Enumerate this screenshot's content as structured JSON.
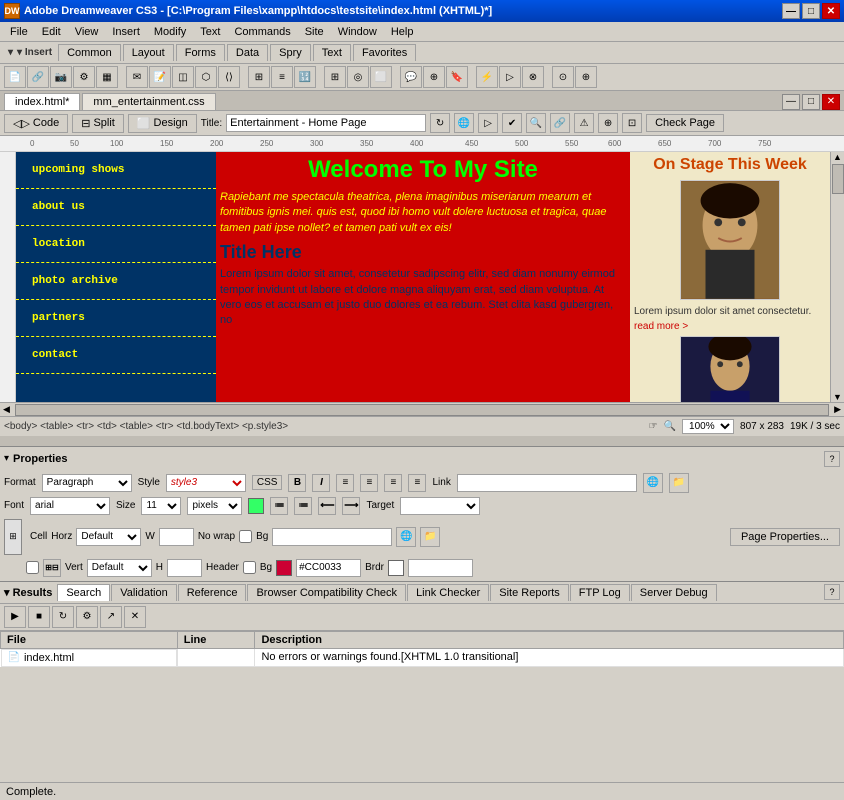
{
  "titlebar": {
    "title": "Adobe Dreamweaver CS3 - [C:\\Program Files\\xampp\\htdocs\\testsite\\index.html (XHTML)*]",
    "icon_label": "DW",
    "min_label": "—",
    "max_label": "□",
    "close_label": "✕"
  },
  "menubar": {
    "items": [
      "File",
      "Edit",
      "View",
      "Insert",
      "Modify",
      "Text",
      "Commands",
      "Site",
      "Window",
      "Help"
    ]
  },
  "insert_toolbar": {
    "label": "▾ Insert",
    "tabs": [
      "Common",
      "Layout",
      "Forms",
      "Data",
      "Spry",
      "Text",
      "Favorites"
    ]
  },
  "doc_tabs": {
    "tabs": [
      "index.html*",
      "mm_entertainment.css"
    ]
  },
  "doc_toolbar": {
    "code_btn": "Code",
    "split_btn": "Split",
    "design_btn": "Design",
    "title_label": "Title:",
    "title_value": "Entertainment - Home Page",
    "check_page_btn": "Check Page"
  },
  "nav_items": [
    "upcoming shows",
    "about us",
    "location",
    "photo archive",
    "partners",
    "contact"
  ],
  "site_title": "Welcome To My Site",
  "body_text": "Rapiebant me spectacula theatrica, plena imaginibus miseriarum mearum et fomitibus ignis mei. quis est, quod ibi homo vult dolere luctuosa et tragica, quae tamen pati ipse nollet? et tamen pati vult ex eis!",
  "title_here": "Title Here",
  "body_text2": "Lorem ipsum dolor sit amet, consetetur sadipscing elitr, sed diam nonumy eirmod tempor invidunt ut labore et dolore magna aliquyam erat, sed diam voluptua. At vero eos et accusam et justo duo dolores et ea rebum. Stet clita kasd gubergren, no",
  "on_stage_title": "On Stage This Week",
  "sidebar_lorem": "Lorem ipsum dolor sit amet consectetur.",
  "read_more": "read more >",
  "status_bar": {
    "breadcrumb": "<body> <table> <tr> <td> <table> <tr> <td.bodyText> <p.style3>",
    "hand_icon": "☞",
    "zoom_icon": "🔍",
    "zoom_value": "100%",
    "size_value": "807 x 283",
    "file_size": "19K / 3 sec"
  },
  "properties": {
    "title": "Properties",
    "format_label": "Format",
    "format_value": "Paragraph",
    "style_label": "Style",
    "style_value": "style3",
    "css_btn": "CSS",
    "bold_btn": "B",
    "italic_btn": "I",
    "link_label": "Link",
    "font_label": "Font",
    "font_value": "arial",
    "size_label": "Size",
    "size_value": "11",
    "size_unit": "pixels",
    "color_value": "#33FF66",
    "target_label": "Target",
    "cell_label": "Cell",
    "horz_label": "Horz",
    "horz_value": "Default",
    "w_label": "W",
    "no_wrap_label": "No wrap",
    "bg_label": "Bg",
    "vert_label": "Vert",
    "vert_value": "Default",
    "h_label": "H",
    "header_label": "Header",
    "bg2_label": "Bg",
    "bg2_color": "#CC0033",
    "brdr_label": "Brdr",
    "page_props_btn": "Page Properties..."
  },
  "results": {
    "title": "▾ Results",
    "tabs": [
      "Search",
      "Validation",
      "Reference",
      "Browser Compatibility Check",
      "Link Checker",
      "Site Reports",
      "FTP Log",
      "Server Debug"
    ],
    "table_headers": [
      "File",
      "Line",
      "Description"
    ],
    "rows": [
      {
        "file": "index.html",
        "line": "",
        "description": "No errors or warnings found.[XHTML 1.0 transitional]"
      }
    ]
  },
  "bottom_status": {
    "text": "Complete."
  }
}
